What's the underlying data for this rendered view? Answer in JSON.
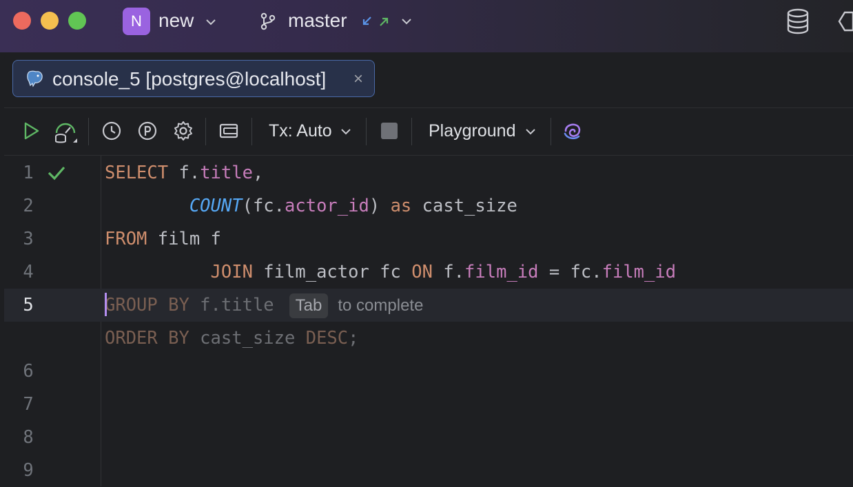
{
  "titlebar": {
    "project_initial": "N",
    "project_name": "new",
    "branch_name": "master",
    "icons": [
      "branch-icon",
      "incoming-outgoing-arrows-icon",
      "database-icon"
    ]
  },
  "tab": {
    "label": "console_5 [postgres@localhost]",
    "close_glyph": "×",
    "icon": "postgresql-elephant-icon"
  },
  "toolbar": {
    "icons": [
      "run-icon",
      "datasource-dashboard-icon",
      "history-icon",
      "parking-p-icon",
      "settings-gear-icon",
      "layout-icon",
      "stop-icon",
      "ai-swirl-icon"
    ],
    "tx_label": "Tx: Auto",
    "schema_label": "Playground"
  },
  "editor": {
    "line_numbers": [
      "1",
      "2",
      "3",
      "4",
      "5",
      "6",
      "7",
      "8",
      "9"
    ],
    "current_line": "5",
    "line1": {
      "kw": "SELECT",
      "a": "f.",
      "b": "title",
      "c": ","
    },
    "line2": {
      "fn": "COUNT",
      "a": "(fc.",
      "b": "actor_id",
      "c": ") ",
      "kw": "as",
      "d": " cast_size"
    },
    "line3": {
      "kw": "FROM",
      "a": " film f"
    },
    "line4": {
      "kw1": "JOIN",
      "a": " film_actor fc ",
      "kw2": "ON",
      "b": " f.",
      "c": "film_id",
      "d": " = fc.",
      "e": "film_id"
    },
    "line5": {
      "ghost_kw": "GROUP BY",
      "ghost_a": " f.title",
      "hint_key": "Tab",
      "hint_text": "to complete"
    },
    "line5b": {
      "ghost_kw1": "ORDER BY",
      "ghost_a": " cast_size ",
      "ghost_kw2": "DESC",
      "ghost_b": ";"
    },
    "colors": {
      "keyword": "#cf8e6d",
      "function": "#56a8f5",
      "field": "#c77dbb",
      "caret": "#b48ef0",
      "check": "#5fb865"
    }
  }
}
